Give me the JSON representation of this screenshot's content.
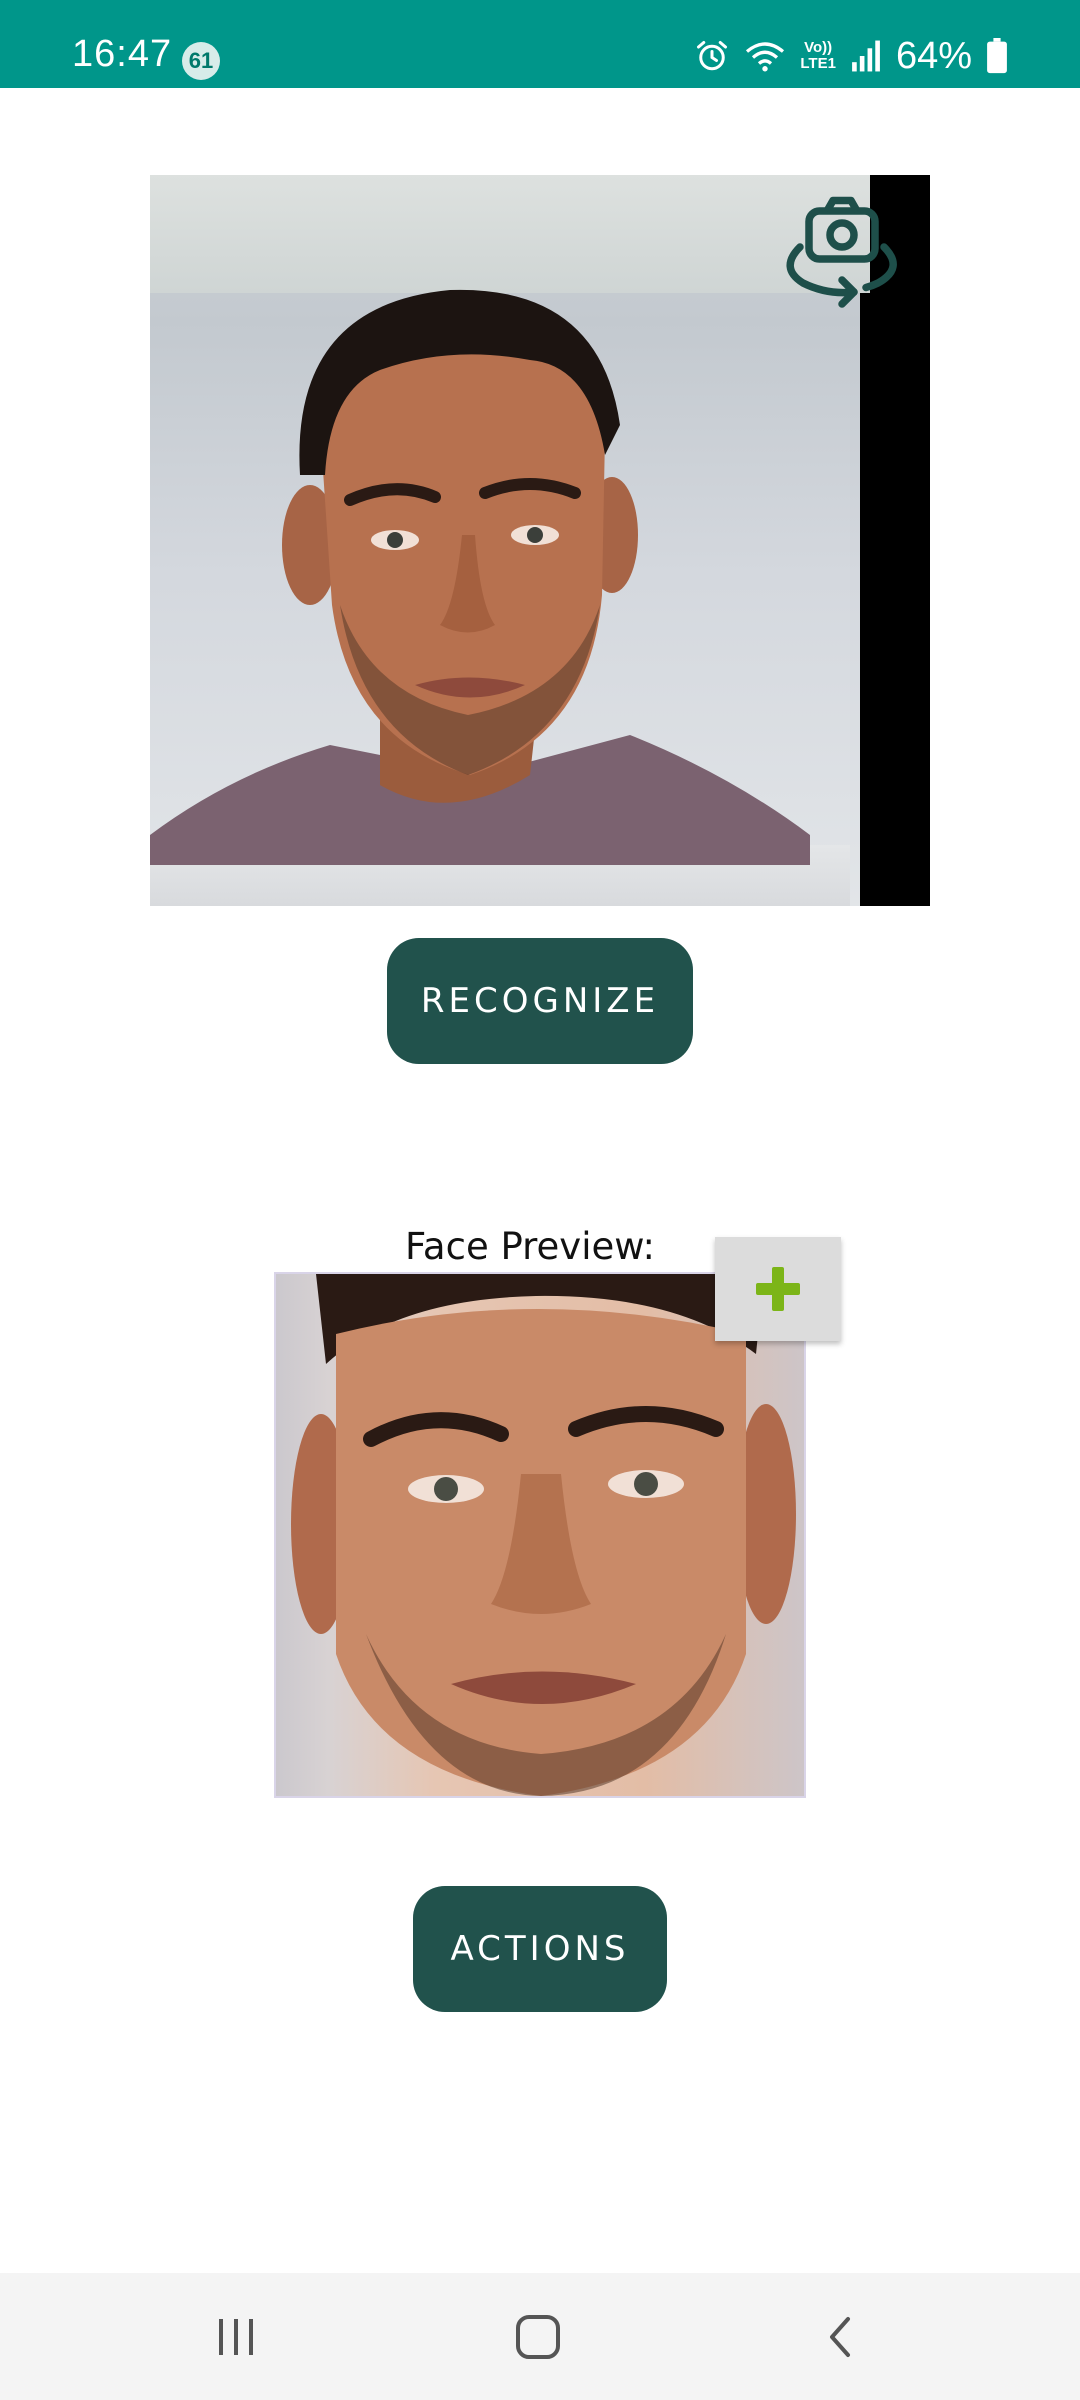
{
  "status_bar": {
    "time": "16:47",
    "notification_count": "61",
    "network_label_top": "Vo))",
    "network_label_bottom": "LTE1",
    "battery_percent": "64%",
    "background_color": "#00968a"
  },
  "camera": {
    "switch_camera_icon": "flip-camera-icon"
  },
  "buttons": {
    "recognize_label": "RECOGNIZE",
    "actions_label": "ACTIONS",
    "add_face_icon": "plus-icon",
    "button_color": "#21524c",
    "add_icon_color": "#7cb518"
  },
  "face_preview": {
    "label": "Face Preview:"
  },
  "nav_bar": {
    "recents_icon": "recents-icon",
    "home_icon": "home-icon",
    "back_icon": "back-icon"
  }
}
